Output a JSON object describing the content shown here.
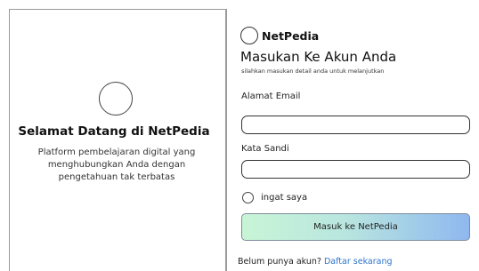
{
  "welcome": {
    "title": "Selamat Datang di NetPedia",
    "description": "Platform pembelajaran digital yang menghubungkan Anda dengan pengetahuan tak terbatas"
  },
  "brand": {
    "name": "NetPedia"
  },
  "form": {
    "title": "Masukan Ke Akun Anda",
    "subtitle": "silahkan masukan detail anda untuk melanjutkan",
    "email_label": "Alamat Email",
    "email_value": "",
    "password_label": "Kata Sandi",
    "password_value": "",
    "remember_label": "ingat saya",
    "submit_label": "Masuk ke NetPedia",
    "signup_prompt": "Belum punya akun?",
    "signup_link": "Daftar sekarang"
  },
  "colors": {
    "link": "#2f74c9",
    "button_gradient_start": "#c8f5d6",
    "button_gradient_end": "#8fb8f0",
    "border": "#9a9a9a"
  },
  "icons": {
    "welcome_logo": "circle-logo-icon",
    "brand_logo": "circle-logo-icon",
    "remember_control": "radio-icon"
  }
}
